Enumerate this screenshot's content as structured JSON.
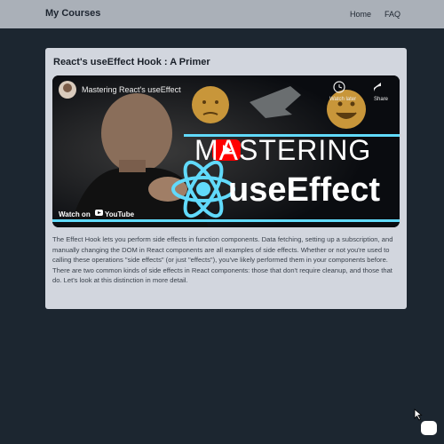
{
  "navbar": {
    "brand": "My Courses",
    "links": [
      {
        "label": "Home"
      },
      {
        "label": "FAQ"
      }
    ]
  },
  "card": {
    "title": "React's useEffect Hook : A Primer",
    "video": {
      "title": "Mastering React's useEffect",
      "headline_top": "MASTERING",
      "headline_bottom": "useEffect",
      "watch_on": "Watch on",
      "youtube": "YouTube",
      "watch_later": "Watch later",
      "share": "Share"
    },
    "description": "The Effect Hook lets you perform side effects in function components. Data fetching, setting up a subscription, and manually changing the DOM in React components are all examples of side effects. Whether or not you're used to calling these operations \"side effects\" (or just \"effects\"), you've likely performed them in your components before. There are two common kinds of side effects in React components: those that don't require cleanup, and those that do. Let's look at this distinction in more detail."
  },
  "colors": {
    "page_bg": "#1c2630",
    "navbar_bg": "#aab0b8",
    "card_bg": "#d2d6de",
    "react_blue": "#61dafb",
    "youtube_red": "#ff0000"
  }
}
